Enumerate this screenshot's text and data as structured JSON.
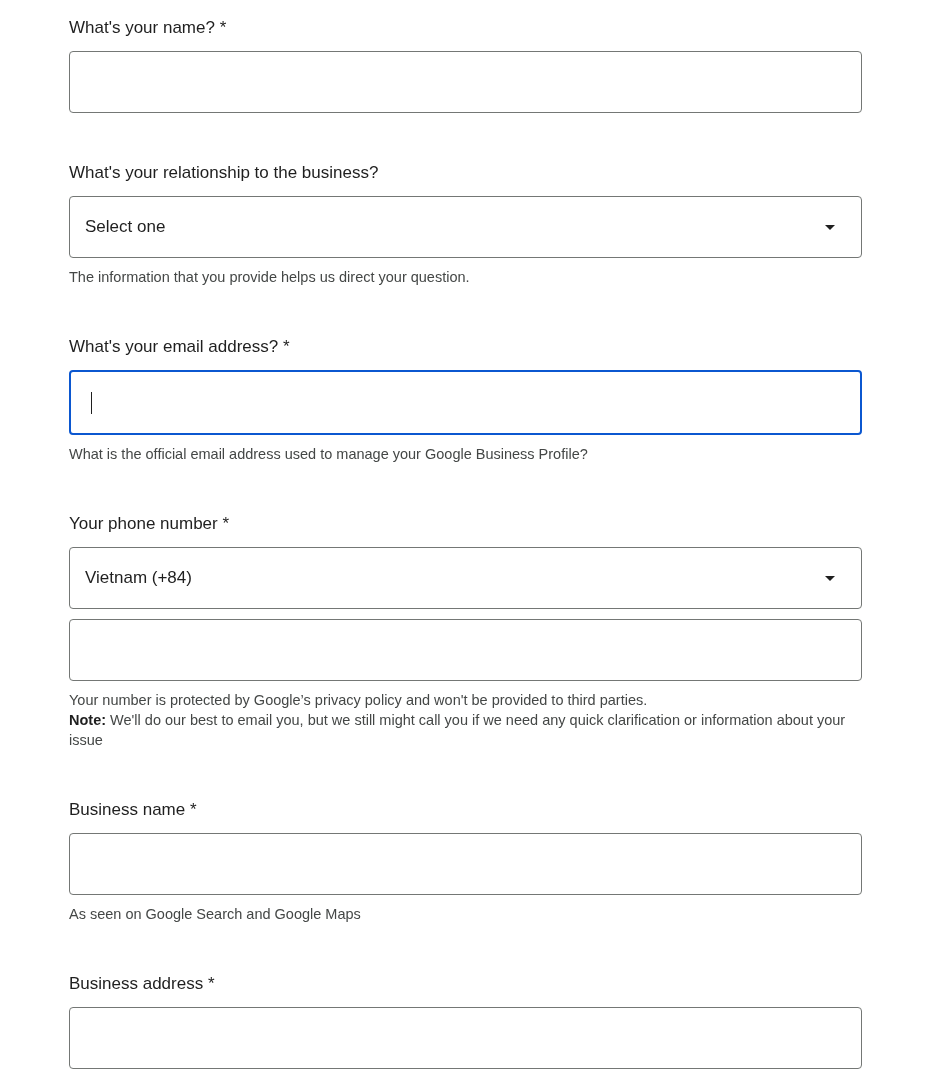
{
  "questions": [
    {
      "label": "What's your name? *",
      "controls": [
        {
          "kind": "text",
          "focused": false
        }
      ]
    },
    {
      "label": "What's your relationship to the business?",
      "controls": [
        {
          "kind": "select",
          "value": "Select one",
          "focused": false
        }
      ],
      "hints": [
        "The information that you provide helps us direct your question."
      ]
    },
    {
      "label": "What's your email address? *",
      "controls": [
        {
          "kind": "text",
          "focused": true
        }
      ],
      "hints": [
        "What is the official email address used to manage your Google Business Profile?"
      ]
    },
    {
      "label": "Your phone number *",
      "controls": [
        {
          "kind": "select",
          "value": "Vietnam (+84)",
          "focused": false
        },
        {
          "kind": "text",
          "focused": false
        }
      ],
      "hints": [
        "Your number is protected by Google’s privacy policy and won't be provided to third parties.",
        "**Note:** We'll do our best to email you, but we still might call you if we need any quick clarification or information about your issue"
      ]
    },
    {
      "label": "Business name *",
      "controls": [
        {
          "kind": "text",
          "focused": false
        }
      ],
      "hints": [
        "As seen on Google Search and Google Maps"
      ]
    },
    {
      "label": "Business address *",
      "controls": [
        {
          "kind": "text",
          "focused": false
        }
      ]
    }
  ]
}
